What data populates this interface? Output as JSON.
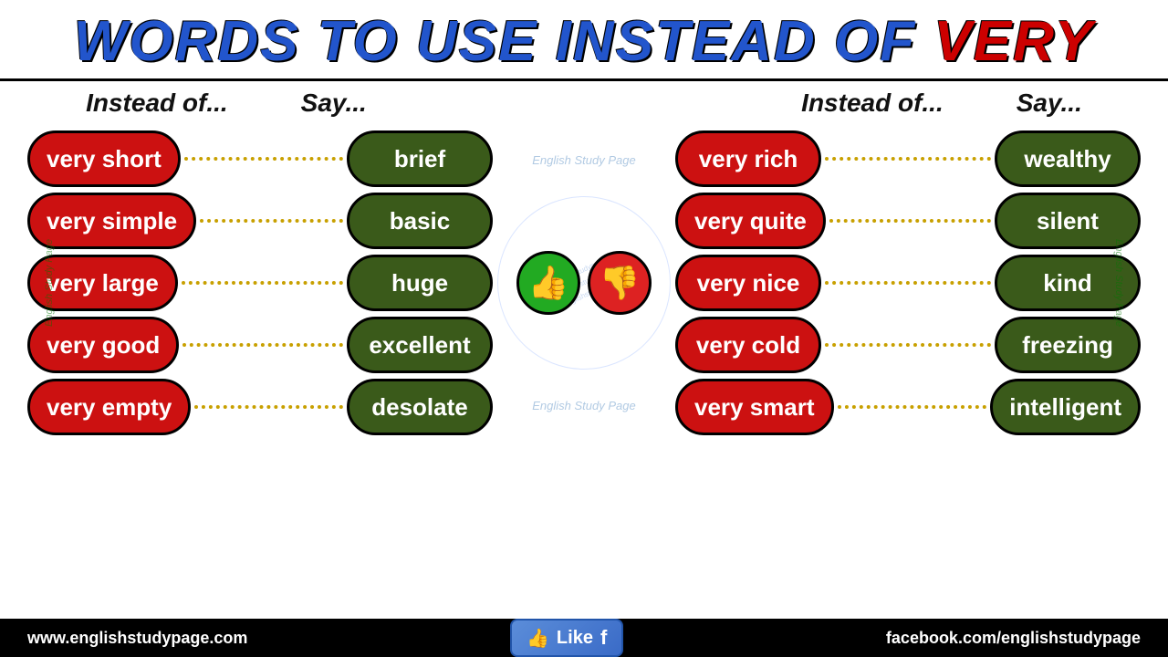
{
  "title": {
    "main": "WORDS TO USE INSTEAD OF ",
    "highlight": "VERY"
  },
  "headers": {
    "instead_of": "Instead of...",
    "say": "Say..."
  },
  "left_pairs": [
    {
      "instead": "very short",
      "say": "brief"
    },
    {
      "instead": "very simple",
      "say": "basic"
    },
    {
      "instead": "very large",
      "say": "huge"
    },
    {
      "instead": "very good",
      "say": "excellent"
    },
    {
      "instead": "very empty",
      "say": "desolate"
    }
  ],
  "right_pairs": [
    {
      "instead": "very rich",
      "say": "wealthy"
    },
    {
      "instead": "very quite",
      "say": "silent"
    },
    {
      "instead": "very nice",
      "say": "kind"
    },
    {
      "instead": "very cold",
      "say": "freezing"
    },
    {
      "instead": "very smart",
      "say": "intelligent"
    }
  ],
  "watermarks": {
    "side_left": "English Study Page",
    "side_right": "English Study Page",
    "center_top": "English Study Page",
    "center_bottom": "English Study Page",
    "circle": "www.englishstudypage.com"
  },
  "bottom": {
    "url_left": "www.englishstudypage.com",
    "like_label": "Like",
    "url_right": "facebook.com/englishstudypage"
  }
}
